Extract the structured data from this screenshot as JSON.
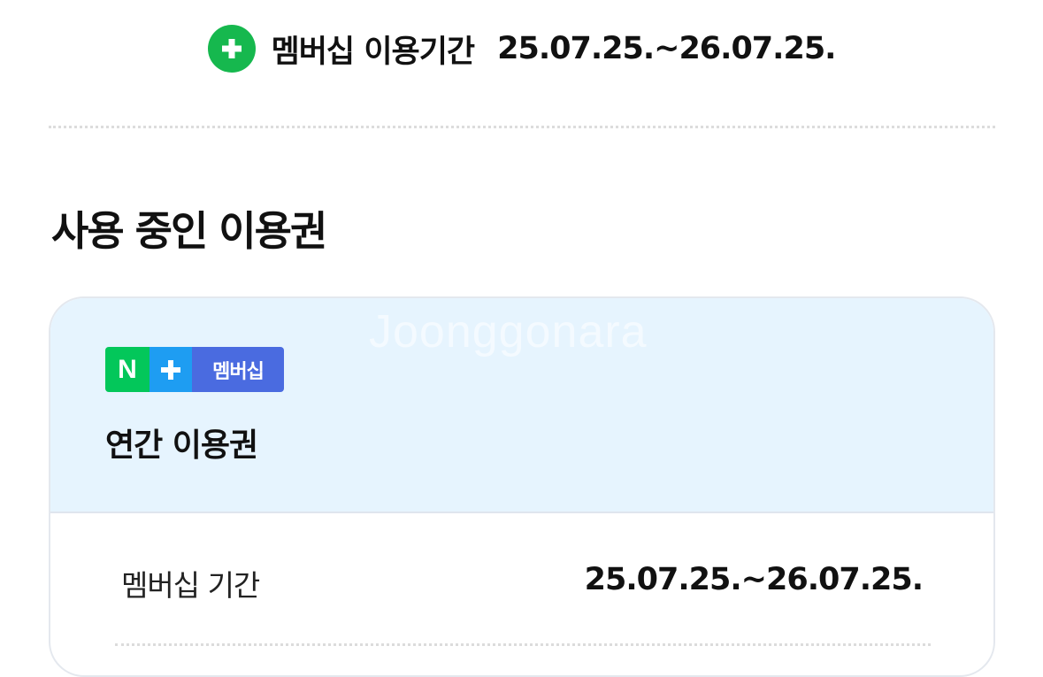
{
  "membership_period": {
    "icon": "plus-circle-icon",
    "label": "멤버십 이용기간",
    "dates": "25.07.25.~26.07.25."
  },
  "section": {
    "title": "사용 중인 이용권"
  },
  "pass_card": {
    "watermark": "Joonggonara",
    "badge": {
      "n_letter": "N",
      "plus_icon": "plus-icon",
      "text": "멤버십"
    },
    "plan_name": "연간 이용권",
    "rows": [
      {
        "label": "멤버십 기간",
        "value": "25.07.25.~26.07.25."
      }
    ]
  },
  "colors": {
    "naver_green": "#03c75a",
    "plus_blue": "#1e9df2",
    "membership_purple": "#4a6be0",
    "card_header_bg": "#e6f4fe",
    "icon_green": "#16b84e"
  }
}
